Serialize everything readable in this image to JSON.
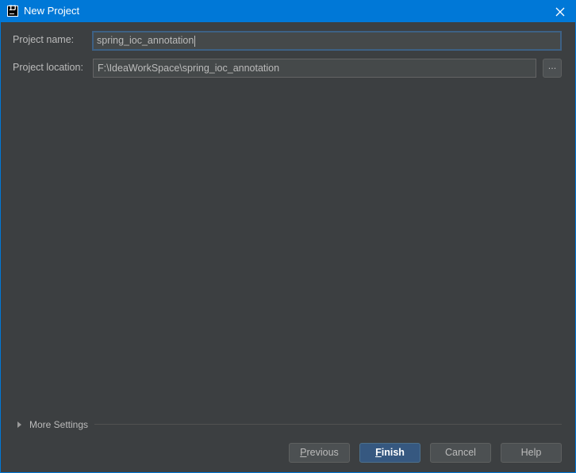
{
  "window": {
    "title": "New Project",
    "accent_color": "#0078d7",
    "icon": "intellij-app-icon",
    "icon_text": "IJ"
  },
  "form": {
    "project_name_label": "Project name:",
    "project_name_value": "spring_ioc_annotation",
    "project_location_label": "Project location:",
    "project_location_value": "F:\\IdeaWorkSpace\\spring_ioc_annotation",
    "browse_label": "..."
  },
  "more_settings": {
    "label": "More Settings",
    "expanded": false
  },
  "buttons": {
    "previous": {
      "mnemonic": "P",
      "rest": "revious"
    },
    "finish": {
      "mnemonic": "F",
      "rest": "inish"
    },
    "cancel": "Cancel",
    "help": "Help"
  }
}
